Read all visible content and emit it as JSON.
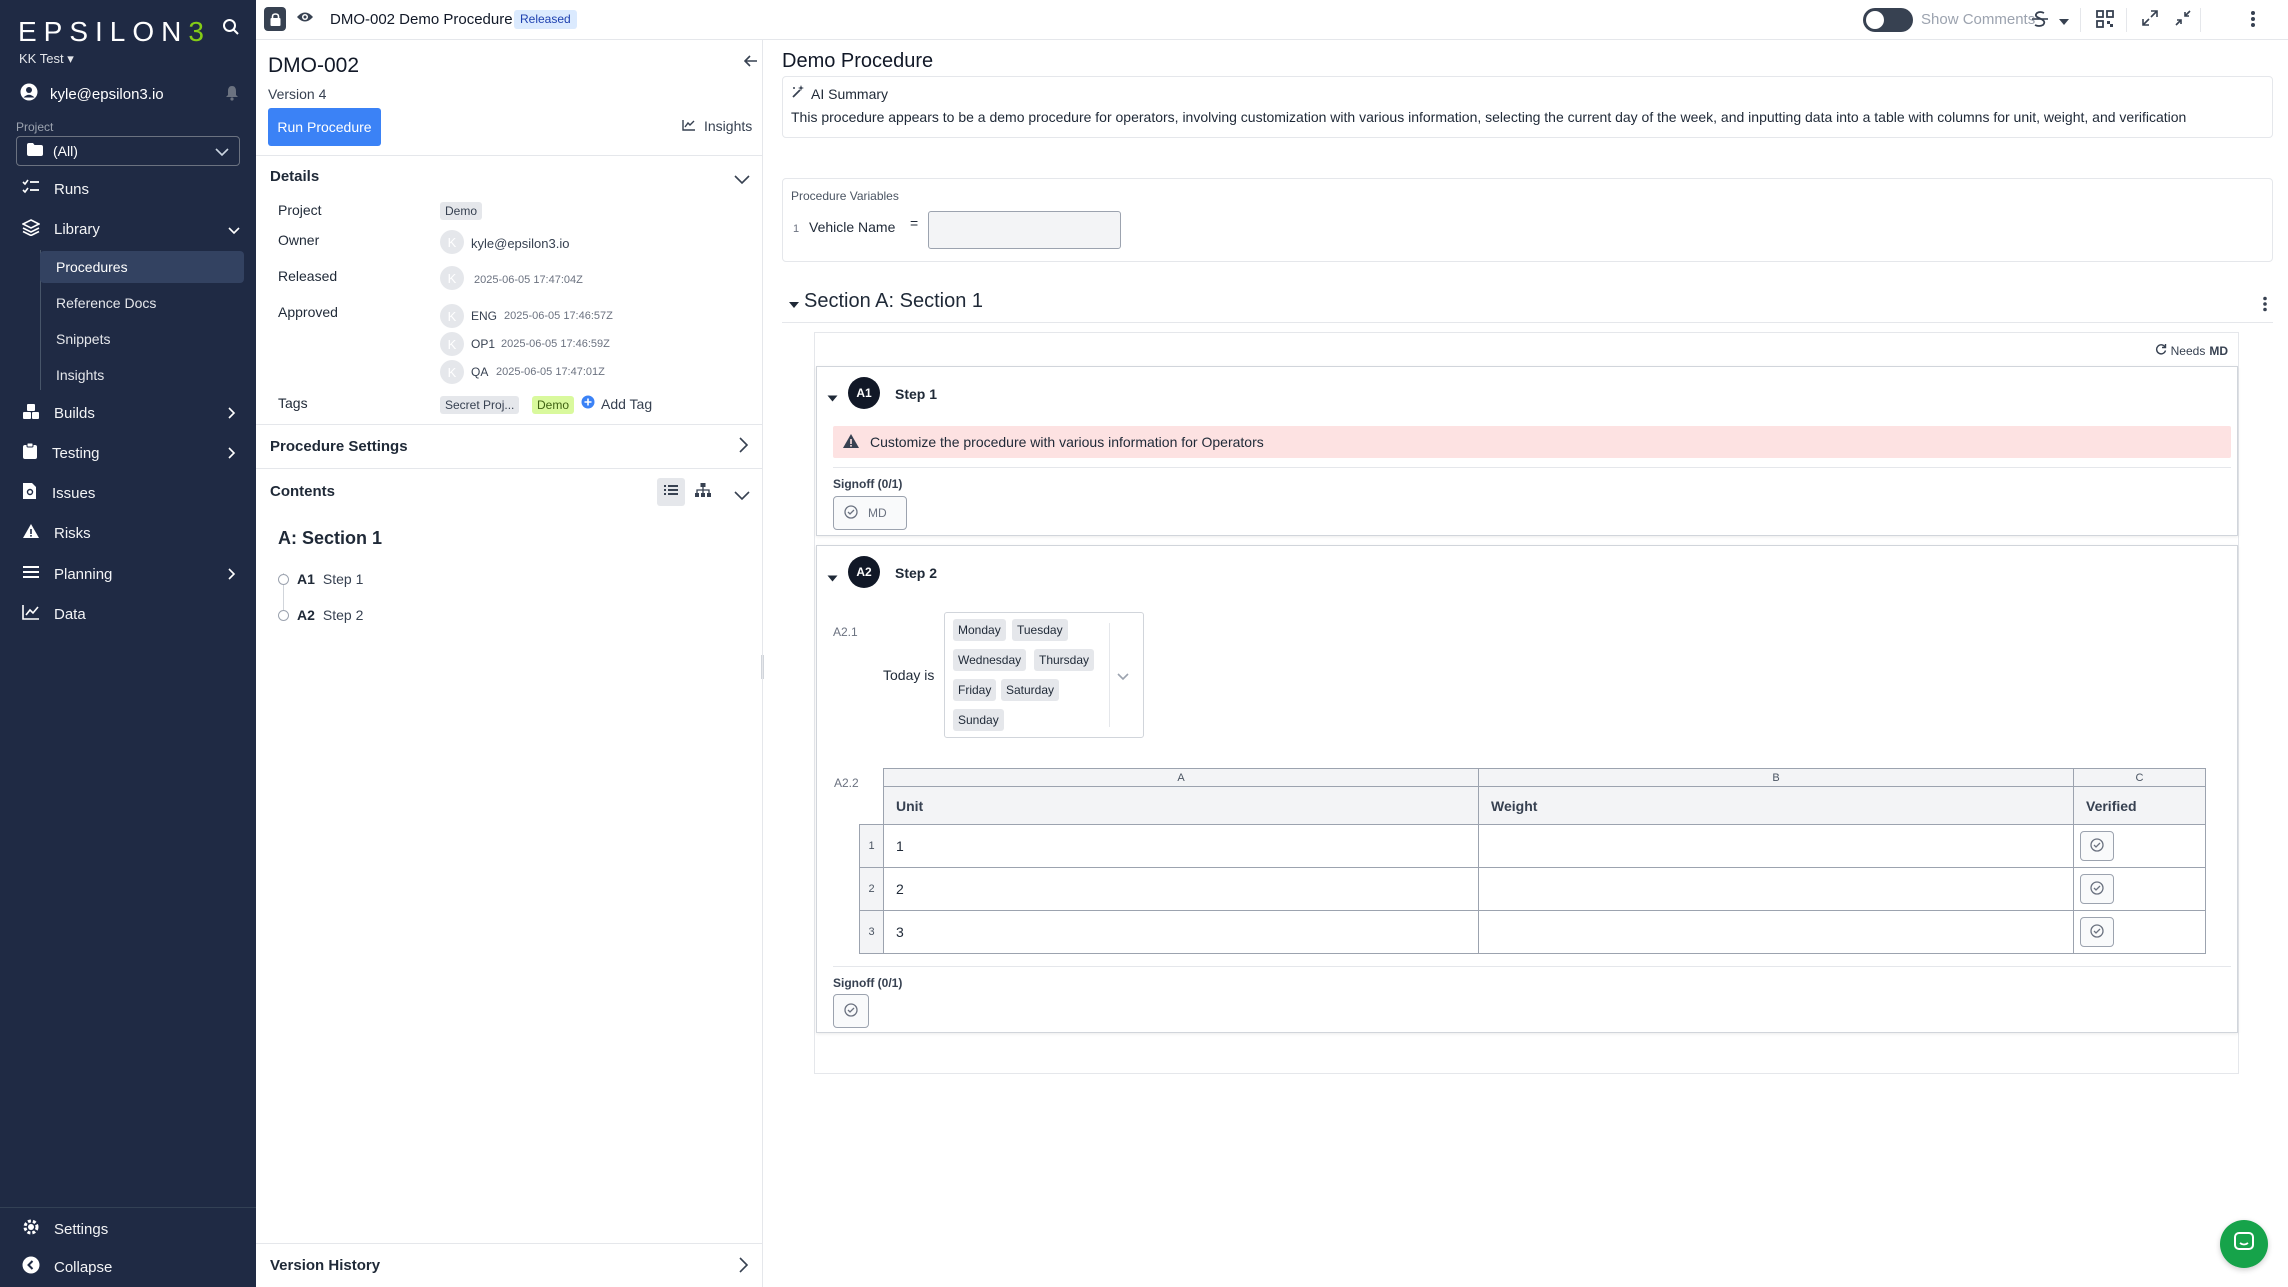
{
  "nav": {
    "logo": "EPSILON3",
    "workspace": "KK Test",
    "user_email": "kyle@epsilon3.io",
    "project_label": "Project",
    "project_value": "(All)",
    "items": {
      "runs": "Runs",
      "library": "Library",
      "procedures": "Procedures",
      "reference_docs": "Reference Docs",
      "snippets": "Snippets",
      "insights": "Insights",
      "builds": "Builds",
      "testing": "Testing",
      "issues": "Issues",
      "risks": "Risks",
      "planning": "Planning",
      "data": "Data",
      "settings": "Settings",
      "collapse": "Collapse"
    }
  },
  "topbar": {
    "title": "DMO-002 Demo Procedure",
    "status_badge": "Released",
    "show_comments": "Show Comments"
  },
  "sidebar": {
    "doc_id": "DMO-002",
    "version": "Version 4",
    "run_button": "Run Procedure",
    "insights": "Insights",
    "details_title": "Details",
    "labels": {
      "project": "Project",
      "owner": "Owner",
      "released": "Released",
      "approved": "Approved",
      "tags": "Tags"
    },
    "project_tag": "Demo",
    "avatar_letter": "K",
    "owner": "kyle@epsilon3.io",
    "released_ts": "2025-06-05 17:47:04Z",
    "approvals": [
      {
        "role": "ENG",
        "ts": "2025-06-05 17:46:57Z"
      },
      {
        "role": "OP1",
        "ts": "2025-06-05 17:46:59Z"
      },
      {
        "role": "QA",
        "ts": "2025-06-05 17:47:01Z"
      }
    ],
    "tags": [
      "Secret Proj...",
      "Demo"
    ],
    "add_tag": "Add Tag",
    "procedure_settings": "Procedure Settings",
    "contents_title": "Contents",
    "toc_section": "A: Section 1",
    "toc_items": [
      {
        "id": "A1",
        "label": "Step 1"
      },
      {
        "id": "A2",
        "label": "Step 2"
      }
    ],
    "version_history": "Version History"
  },
  "main": {
    "title": "Demo Procedure",
    "ai_summary_title": "AI Summary",
    "ai_summary_text": "This procedure appears to be a demo procedure for operators, involving customization with various information, selecting the current day of the week, and inputting data into a table with columns for unit, weight, and verification",
    "variables_title": "Procedure Variables",
    "variables": [
      {
        "num": "1",
        "name": "Vehicle Name",
        "eq": "=",
        "value": ""
      }
    ],
    "section_title": "Section A: Section 1",
    "needs_label": "Needs",
    "needs_role": "MD",
    "steps": [
      {
        "badge": "A1",
        "title": "Step 1",
        "warning": "Customize the procedure with various information for Operators",
        "signoff_label": "Signoff (0/1)",
        "signoff_role": "MD"
      },
      {
        "badge": "A2",
        "title": "Step 2",
        "field_ref": "A2.1",
        "field_label": "Today is",
        "days": [
          "Monday",
          "Tuesday",
          "Wednesday",
          "Thursday",
          "Friday",
          "Saturday",
          "Sunday"
        ],
        "table_ref": "A2.2",
        "table": {
          "col_letters": [
            "A",
            "B",
            "C"
          ],
          "headers": [
            "Unit",
            "Weight",
            "Verified"
          ],
          "rows": [
            {
              "num": "1",
              "unit": "1",
              "weight": ""
            },
            {
              "num": "2",
              "unit": "2",
              "weight": ""
            },
            {
              "num": "3",
              "unit": "3",
              "weight": ""
            }
          ]
        },
        "signoff_label": "Signoff (0/1)"
      }
    ]
  },
  "colors": {
    "nav_bg": "#1f2a44",
    "accent_blue": "#3b82f6",
    "logo_accent": "#84cc16",
    "warning_bg": "#fde2e2",
    "chat_green": "#16a34a"
  }
}
